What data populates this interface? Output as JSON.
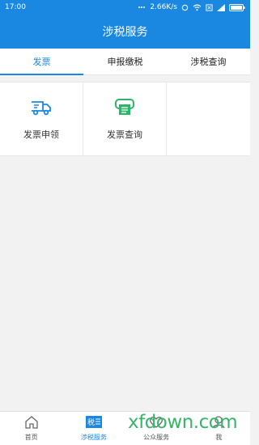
{
  "status_bar": {
    "time": "17:00",
    "speed": "2.66K/s"
  },
  "header": {
    "title": "涉税服务"
  },
  "tabs": [
    {
      "label": "发票",
      "active": true
    },
    {
      "label": "申报缴税",
      "active": false
    },
    {
      "label": "涉税查询",
      "active": false
    }
  ],
  "grid": [
    {
      "label": "发票申领",
      "icon": "delivery-truck-icon"
    },
    {
      "label": "发票查询",
      "icon": "receipt-print-icon"
    }
  ],
  "bottom_nav": [
    {
      "label": "首页",
      "icon": "home-icon",
      "active": false
    },
    {
      "label": "涉税服务",
      "icon": "tax-icon",
      "active": true,
      "icon_text": "税"
    },
    {
      "label": "公众服务",
      "icon": "heart-icon",
      "active": false
    },
    {
      "label": "我",
      "icon": "user-icon",
      "active": false
    }
  ],
  "watermark": "xfdown.com",
  "colors": {
    "primary": "#1a87e1",
    "accent_green": "#2fb36b",
    "background": "#f2f2f2"
  }
}
